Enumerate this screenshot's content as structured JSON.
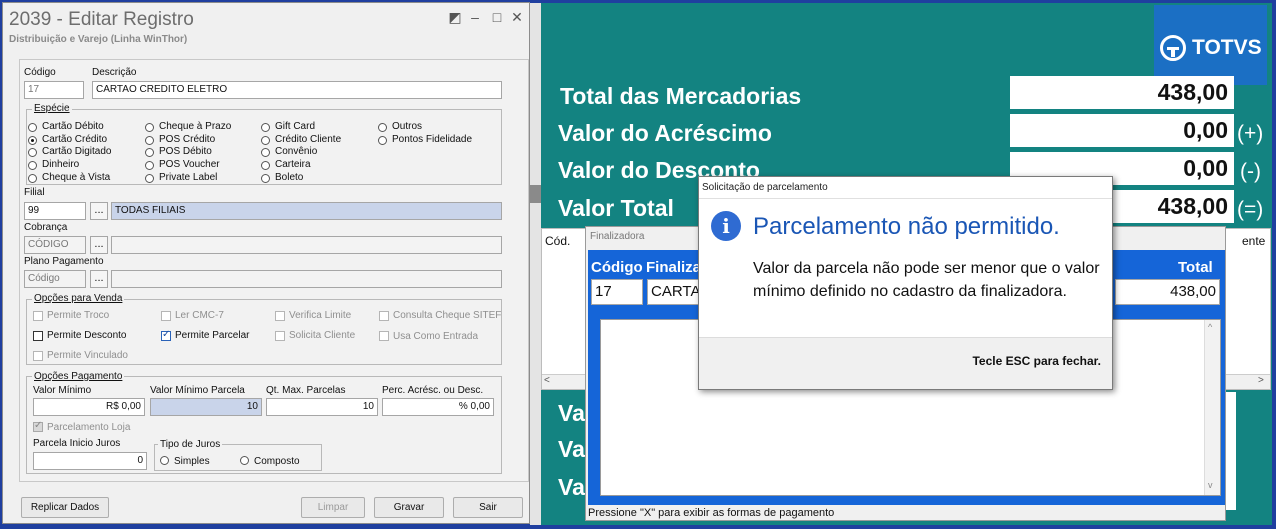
{
  "edit_window": {
    "title": "2039 - Editar Registro",
    "subtitle": "Distribuição e Varejo (Linha WinThor)",
    "codigo_label": "Código",
    "codigo_value": "17",
    "descricao_label": "Descrição",
    "descricao_value": "CARTAO CREDITO ELETRO",
    "especie_label": "Espécie",
    "especie_options": [
      "Cartão Débito",
      "Cartão Crédito",
      "Cartão Digitado",
      "Dinheiro",
      "Cheque à Vista",
      "Cheque à Prazo",
      "POS Crédito",
      "POS Débito",
      "POS Voucher",
      "Private Label",
      "Gift Card",
      "Crédito Cliente",
      "Convênio",
      "Carteira",
      "Boleto",
      "Outros",
      "Pontos Fidelidade"
    ],
    "especie_selected": "Cartão Crédito",
    "filial_label": "Filial",
    "filial_code": "99",
    "filial_desc": "TODAS FILIAIS",
    "cobranca_label": "Cobrança",
    "cobranca_code": "CÓDIGO",
    "plano_label": "Plano Pagamento",
    "plano_code": "Código",
    "dots": "...",
    "opcoes_venda_label": "Opções para Venda",
    "venda_options": {
      "permite_troco": "Permite Troco",
      "ler_cmc7": "Ler CMC-7",
      "verifica_limite": "Verifica Limite",
      "consulta_cheque": "Consulta Cheque SITEF",
      "permite_desconto": "Permite Desconto",
      "permite_parcelar": "Permite Parcelar",
      "solicita_cliente": "Solicita Cliente",
      "usa_como_entrada": "Usa Como Entrada",
      "permite_vinculado": "Permite Vinculado"
    },
    "opcoes_pagamento_label": "Opções Pagamento",
    "valor_minimo_label": "Valor Mínimo",
    "valor_minimo_value": "R$ 0,00",
    "valor_min_parcela_label": "Valor Mínimo Parcela",
    "valor_min_parcela_value": "10",
    "qt_max_parcelas_label": "Qt. Max. Parcelas",
    "qt_max_parcelas_value": "10",
    "perc_acresc_label": "Perc. Acrésc. ou Desc.",
    "perc_acresc_value": "% 0,00",
    "parcelamento_loja_label": "Parcelamento Loja",
    "parcela_inicio_juros_label": "Parcela Inicio Juros",
    "parcela_inicio_juros_value": "0",
    "tipo_juros_label": "Tipo de Juros",
    "juros_simples": "Simples",
    "juros_composto": "Composto",
    "replicar_label": "Replicar Dados",
    "limpar_label": "Limpar",
    "gravar_label": "Gravar",
    "sair_label": "Sair"
  },
  "totals": {
    "brand": "TOTVS",
    "total_mercadorias_label": "Total das Mercadorias",
    "total_mercadorias_value": "438,00",
    "acrescimo_label": "Valor do Acréscimo",
    "acrescimo_value": "0,00",
    "acrescimo_sign": "(+)",
    "desconto_label": "Valor do Desconto",
    "desconto_value": "0,00",
    "desconto_sign": "(-)",
    "total_label": "Valor Total",
    "total_value": "438,00",
    "total_sign": "(=)",
    "cod_label": "Cód.",
    "ente_label": "ente",
    "va_label": "Va"
  },
  "finalizadora": {
    "title": "Finalizadora",
    "codigo_header": "Código",
    "finaliza_header": "Finaliza",
    "total_header": "Total",
    "codigo_value": "17",
    "finaliza_value": "CARTA",
    "total_value": "438,00",
    "footer": "Pressione \"X\" para exibir as formas de pagamento"
  },
  "dialog": {
    "title": "Solicitação de parcelamento",
    "heading": "Parcelamento não permitido.",
    "message": "Valor da parcela não pode ser menor que o valor mínimo definido no cadastro da finalizadora.",
    "footer": "Tecle ESC para fechar."
  }
}
